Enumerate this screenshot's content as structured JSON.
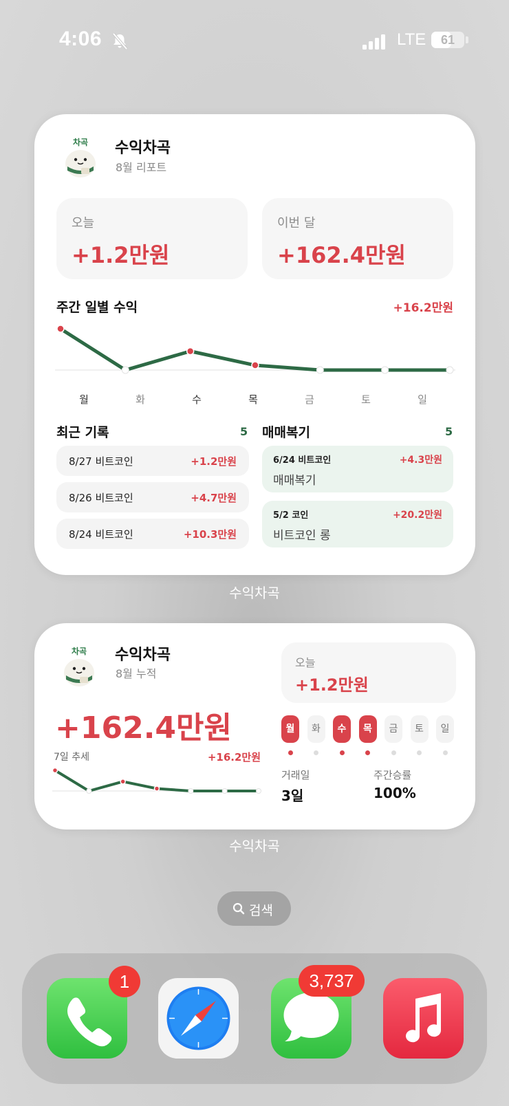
{
  "status_bar": {
    "time": "4:06",
    "network": "LTE",
    "battery": "61",
    "battery_level": 0.61
  },
  "widget_large": {
    "mascot_label": "차곡",
    "title": "수익차곡",
    "subtitle": "8월 리포트",
    "today": {
      "label": "오늘",
      "value": "+1.2만원"
    },
    "month": {
      "label": "이번 달",
      "value": "+162.4만원"
    },
    "weekly": {
      "title": "주간 일별 수익",
      "total": "+16.2만원"
    },
    "recent": {
      "title": "최근 기록",
      "count": "5",
      "items": [
        {
          "label": "8/27 비트코인",
          "value": "+1.2만원"
        },
        {
          "label": "8/26 비트코인",
          "value": "+4.7만원"
        },
        {
          "label": "8/24 비트코인",
          "value": "+10.3만원"
        }
      ]
    },
    "review": {
      "title": "매매복기",
      "count": "5",
      "items": [
        {
          "label": "6/24 비트코인",
          "value": "+4.3만원",
          "memo": "매매복기"
        },
        {
          "label": "5/2 코인",
          "value": "+20.2만원",
          "memo": "비트코인 롱"
        }
      ]
    },
    "caption": "수익차곡"
  },
  "widget_medium": {
    "mascot_label": "차곡",
    "title": "수익차곡",
    "subtitle": "8월 누적",
    "total": "+162.4만원",
    "trend_label": "7일 추세",
    "trend_value": "+16.2만원",
    "today": {
      "label": "오늘",
      "value": "+1.2만원"
    },
    "days": [
      {
        "label": "월",
        "active": true
      },
      {
        "label": "화",
        "active": false
      },
      {
        "label": "수",
        "active": true
      },
      {
        "label": "목",
        "active": true
      },
      {
        "label": "금",
        "active": false
      },
      {
        "label": "토",
        "active": false
      },
      {
        "label": "일",
        "active": false
      }
    ],
    "stats": [
      {
        "label": "거래일",
        "value": "3일"
      },
      {
        "label": "주간승률",
        "value": "100%"
      }
    ],
    "caption": "수익차곡"
  },
  "chart_data": {
    "type": "line",
    "categories": [
      "월",
      "화",
      "수",
      "목",
      "금",
      "토",
      "일"
    ],
    "series": [
      {
        "values": [
          10.3,
          0,
          4.7,
          1.2,
          0,
          0,
          0
        ]
      }
    ],
    "title": "주간 일별 수익",
    "xlabel": "",
    "ylabel": "",
    "ylim": [
      0,
      10.3
    ],
    "grid": false,
    "colors": {
      "line": "#2d6a45",
      "positive_point": "#d9434b",
      "zero_point": "#ffffff"
    }
  },
  "search": {
    "label": "검색"
  },
  "dock": {
    "apps": [
      {
        "name": "phone-icon",
        "badge": "1"
      },
      {
        "name": "safari-icon",
        "badge": ""
      },
      {
        "name": "messages-icon",
        "badge": "3,737"
      },
      {
        "name": "music-icon",
        "badge": ""
      }
    ]
  },
  "colors": {
    "accent_red": "#d9434b",
    "accent_green": "#2d6a45",
    "badge_red": "#f03a35"
  }
}
